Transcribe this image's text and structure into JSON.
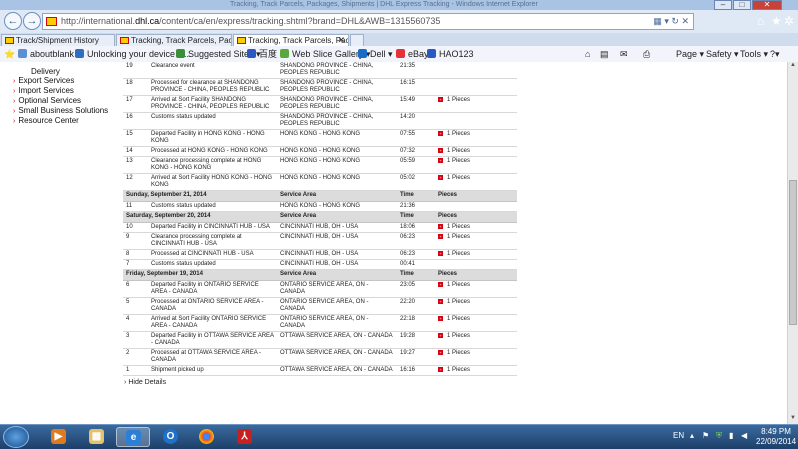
{
  "window": {
    "title": "Tracking, Track Parcels, Packages, Shipments | DHL Express Tracking - Windows Internet Explorer"
  },
  "address": {
    "url_prefix": "http://international.",
    "url_domain": "dhl.ca",
    "url_path": "/content/ca/en/express/tracking.shtml?brand=DHL&AWB=1315560735"
  },
  "tabs": [
    {
      "label": "Track/Shipment History"
    },
    {
      "label": "Tracking, Track Parcels, Packa..."
    },
    {
      "label": "Tracking, Track Parcels, Pac..."
    }
  ],
  "favorites": [
    {
      "label": "aboutblank"
    },
    {
      "label": "Unlocking your device  U..."
    },
    {
      "label": "Suggested Sites ▾"
    },
    {
      "label": "百度"
    },
    {
      "label": "Web Slice Gallery ▾"
    },
    {
      "label": "Dell ▾"
    },
    {
      "label": "eBay"
    },
    {
      "label": "HAO123"
    }
  ],
  "commands": [
    {
      "label": "Page ▾"
    },
    {
      "label": "Safety ▾"
    },
    {
      "label": "Tools ▾"
    }
  ],
  "sidebar": [
    {
      "label": "Delivery"
    },
    {
      "label": "Export Services"
    },
    {
      "label": "Import Services"
    },
    {
      "label": "Optional Services"
    },
    {
      "label": "Small Business Solutions"
    },
    {
      "label": "Resource Center"
    }
  ],
  "tracking": {
    "headers": {
      "area": "Service Area",
      "time": "Time",
      "pieces": "Pieces"
    },
    "rows": [
      {
        "type": "event",
        "num": "19",
        "desc": "Clearance event",
        "area": "SHANDONG PROVINCE - CHINA, PEOPLES REPUBLIC",
        "time": "21:35",
        "pieces": ""
      },
      {
        "type": "event",
        "num": "18",
        "desc": "Processed for clearance at SHANDONG PROVINCE - CHINA, PEOPLES REPUBLIC",
        "area": "SHANDONG PROVINCE - CHINA, PEOPLES REPUBLIC",
        "time": "16:15",
        "pieces": ""
      },
      {
        "type": "event",
        "num": "17",
        "desc": "Arrived at Sort Facility SHANDONG PROVINCE - CHINA, PEOPLES REPUBLIC",
        "area": "SHANDONG PROVINCE - CHINA, PEOPLES REPUBLIC",
        "time": "15:49",
        "pieces": "1 Pieces"
      },
      {
        "type": "event",
        "num": "16",
        "desc": "Customs status updated",
        "area": "SHANDONG PROVINCE - CHINA, PEOPLES REPUBLIC",
        "time": "14:20",
        "pieces": ""
      },
      {
        "type": "event",
        "num": "15",
        "desc": "Departed Facility in HONG KONG - HONG KONG",
        "area": "HONG KONG - HONG KONG",
        "time": "07:55",
        "pieces": "1 Pieces"
      },
      {
        "type": "event",
        "num": "14",
        "desc": "Processed at HONG KONG - HONG KONG",
        "area": "HONG KONG - HONG KONG",
        "time": "07:32",
        "pieces": "1 Pieces"
      },
      {
        "type": "event",
        "num": "13",
        "desc": "Clearance processing complete at HONG KONG - HONG KONG",
        "area": "HONG KONG - HONG KONG",
        "time": "05:59",
        "pieces": "1 Pieces"
      },
      {
        "type": "event",
        "num": "12",
        "desc": "Arrived at Sort Facility HONG KONG - HONG KONG",
        "area": "HONG KONG - HONG KONG",
        "time": "05:02",
        "pieces": "1 Pieces"
      },
      {
        "type": "day",
        "date": "Sunday, September 21, 2014"
      },
      {
        "type": "event",
        "num": "11",
        "desc": "Customs status updated",
        "area": "HONG KONG - HONG KONG",
        "time": "21:36",
        "pieces": ""
      },
      {
        "type": "day",
        "date": "Saturday, September 20, 2014"
      },
      {
        "type": "event",
        "num": "10",
        "desc": "Departed Facility in CINCINNATI HUB - USA",
        "area": "CINCINNATI HUB, OH - USA",
        "time": "18:06",
        "pieces": "1 Pieces"
      },
      {
        "type": "event",
        "num": "9",
        "desc": "Clearance processing complete at CINCINNATI HUB - USA",
        "area": "CINCINNATI HUB, OH - USA",
        "time": "06:23",
        "pieces": "1 Pieces"
      },
      {
        "type": "event",
        "num": "8",
        "desc": "Processed at CINCINNATI HUB - USA",
        "area": "CINCINNATI HUB, OH - USA",
        "time": "06:23",
        "pieces": "1 Pieces"
      },
      {
        "type": "event",
        "num": "7",
        "desc": "Customs status updated",
        "area": "CINCINNATI HUB, OH - USA",
        "time": "00:41",
        "pieces": ""
      },
      {
        "type": "day",
        "date": "Friday, September 19, 2014"
      },
      {
        "type": "event",
        "num": "6",
        "desc": "Departed Facility in ONTARIO SERVICE AREA - CANADA",
        "area": "ONTARIO SERVICE AREA, ON - CANADA",
        "time": "23:05",
        "pieces": "1 Pieces"
      },
      {
        "type": "event",
        "num": "5",
        "desc": "Processed at ONTARIO SERVICE AREA - CANADA",
        "area": "ONTARIO SERVICE AREA, ON - CANADA",
        "time": "22:20",
        "pieces": "1 Pieces"
      },
      {
        "type": "event",
        "num": "4",
        "desc": "Arrived at Sort Facility ONTARIO SERVICE AREA - CANADA",
        "area": "ONTARIO SERVICE AREA, ON - CANADA",
        "time": "22:18",
        "pieces": "1 Pieces"
      },
      {
        "type": "event",
        "num": "3",
        "desc": "Departed Facility in OTTAWA SERVICE AREA - CANADA",
        "area": "OTTAWA SERVICE AREA, ON - CANADA",
        "time": "19:28",
        "pieces": "1 Pieces"
      },
      {
        "type": "event",
        "num": "2",
        "desc": "Processed at OTTAWA SERVICE AREA - CANADA",
        "area": "OTTAWA SERVICE AREA, ON - CANADA",
        "time": "19:27",
        "pieces": "1 Pieces"
      },
      {
        "type": "event",
        "num": "1",
        "desc": "Shipment picked up",
        "area": "OTTAWA SERVICE AREA, ON - CANADA",
        "time": "16:16",
        "pieces": "1 Pieces"
      }
    ],
    "hide_details": "Hide Details"
  },
  "taskbar": {
    "lang": "EN",
    "time": "8:49 PM",
    "date": "22/09/2014"
  },
  "colors": {
    "dhl_red": "#d40511",
    "dhl_yellow": "#ffcc00"
  }
}
